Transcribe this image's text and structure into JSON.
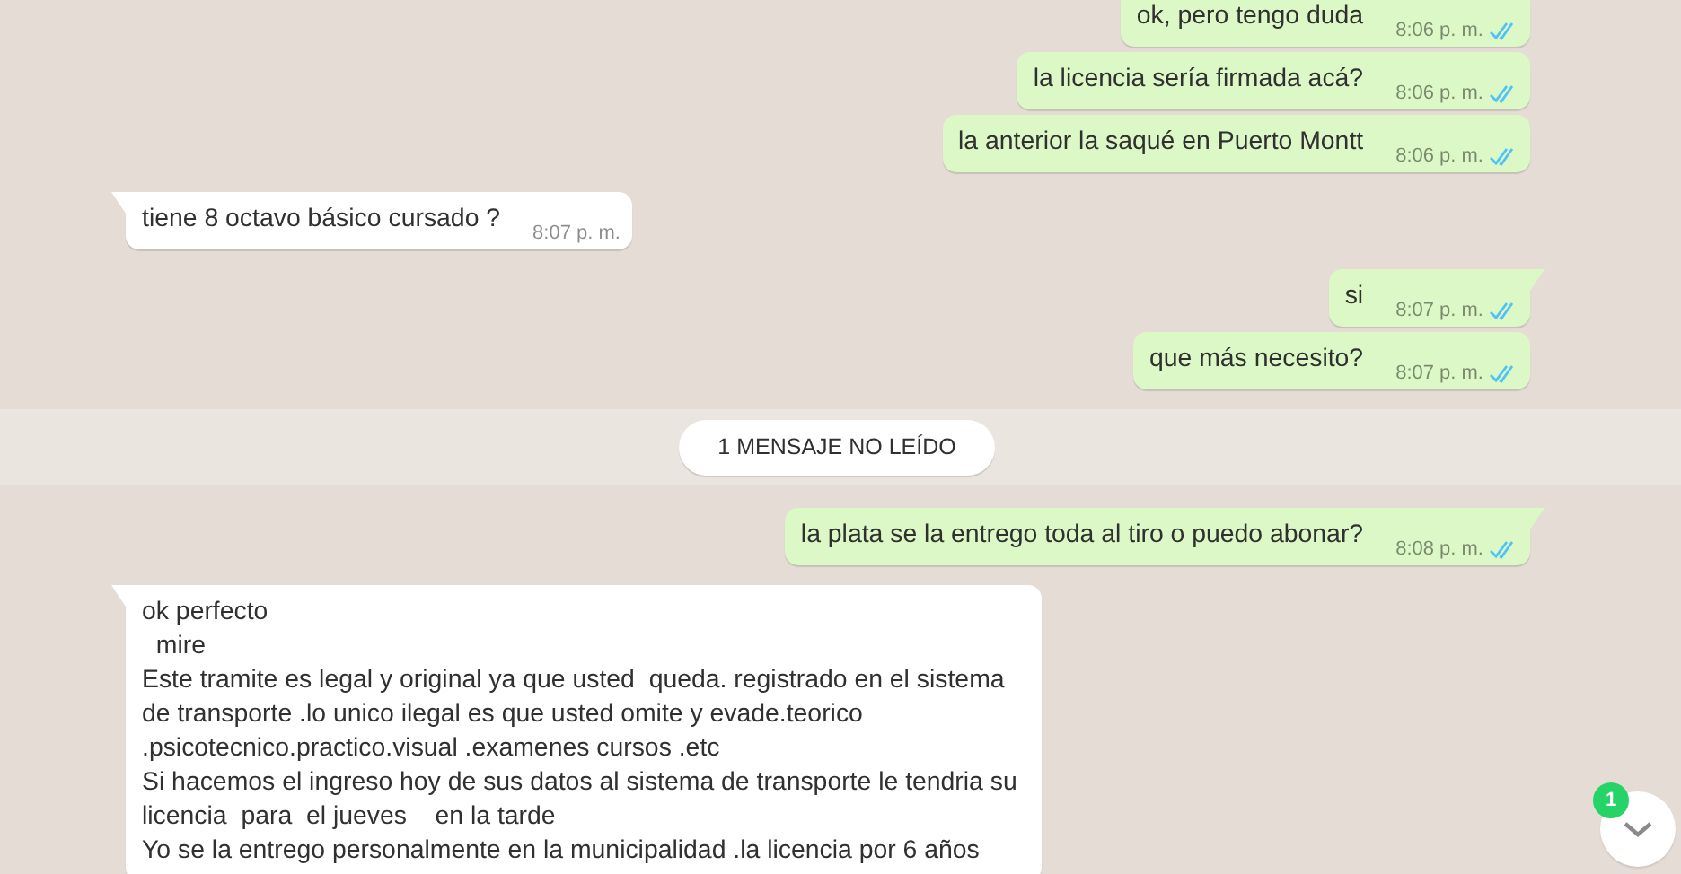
{
  "messages": [
    {
      "kind": "outgoing",
      "text": "ok, pero tengo duda",
      "time": "8:06 p. m.",
      "tail": false,
      "read": true
    },
    {
      "kind": "outgoing",
      "text": "la licencia sería firmada acá?",
      "time": "8:06 p. m.",
      "tail": false,
      "read": true
    },
    {
      "kind": "outgoing",
      "text": "la anterior la saqué en Puerto Montt",
      "time": "8:06 p. m.",
      "tail": false,
      "read": true
    },
    {
      "kind": "incoming",
      "text": "tiene 8 octavo básico cursado ?",
      "time": "8:07 p. m.",
      "tail": true
    },
    {
      "kind": "outgoing",
      "text": "si",
      "time": "8:07 p. m.",
      "tail": true,
      "read": true
    },
    {
      "kind": "outgoing",
      "text": "que más necesito?",
      "time": "8:07 p. m.",
      "tail": false,
      "read": true
    },
    {
      "kind": "divider",
      "text": "1 MENSAJE NO LEÍDO"
    },
    {
      "kind": "outgoing",
      "text": "la plata se la entrego toda al tiro o puedo abonar?",
      "time": "8:08 p. m.",
      "tail": true,
      "read": true
    },
    {
      "kind": "incoming",
      "text": "ok perfecto\n  mire\nEste tramite es legal y original ya que usted  queda. registrado en el sistema de transporte .lo unico ilegal es que usted omite y evade.teorico .psicotecnico.practico.visual .examenes cursos .etc\nSi hacemos el ingreso hoy de sus datos al sistema de transporte le tendria su licencia  para  el jueves    en la tarde\nYo se la entrego personalmente en la municipalidad .la licencia por 6 años",
      "tail": true
    }
  ],
  "scroll_button": {
    "badge": "1"
  }
}
